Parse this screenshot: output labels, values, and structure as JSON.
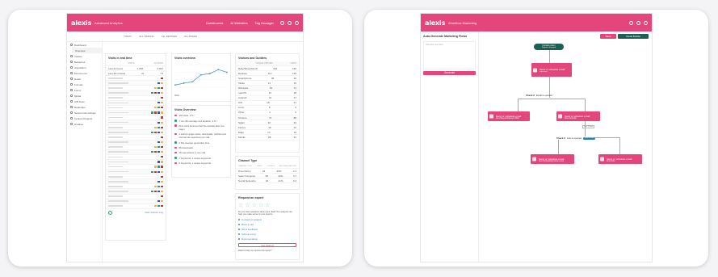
{
  "left": {
    "brand": "alexis",
    "app_title": "Advanced Analytics",
    "nav": [
      "Dashboards",
      "AI Websites",
      "Tag Manager"
    ],
    "filters": [
      "TODAY",
      "ALL TRAFFIC",
      "ALL DEVICES",
      "ALL PAGES"
    ],
    "sidebar": [
      "Dashboard",
      "Overview",
      "Visitors",
      "Behaviour",
      "Acquisition",
      "Ecommerce",
      "Goals",
      "Funnels",
      "Forms",
      "Media",
      "A/B Tests",
      "Heatmaps",
      "Session Recordings",
      "Content Projects",
      "Crashes"
    ],
    "visits": {
      "title": "Visits in real time",
      "headers": [
        "",
        "VISITS",
        "ACTIONS"
      ],
      "summary": [
        [
          "Last 24 hours",
          "1,084",
          "3,812"
        ],
        [
          "Last 30 minutes",
          "21",
          "74"
        ]
      ],
      "rows_count": 27,
      "more_link": "View Visitors Log"
    },
    "overview_title": "Visits overview",
    "chart_data": {
      "type": "line",
      "x": [
        "",
        "",
        "",
        "",
        "",
        "",
        ""
      ],
      "series": [
        {
          "values": [
            10,
            18,
            24,
            55,
            60,
            78,
            66
          ]
        }
      ],
      "legend": "Visits"
    },
    "visit_overview": {
      "title": "Visits Overview",
      "items": [
        "192 visits, 2 % ↑",
        "3 min 35s average visit duration, 4 % ↑",
        "61% visits bounced (left the website after one page)",
        "4 actions (page views, downloads, outlinks and internal site searches) per visit",
        "0.63s average generation time",
        "88 downloads",
        "18 max actions in one visit",
        "1 Keywords, 1 unique keywords",
        "8 Keywords, 1 unique keywords"
      ]
    },
    "matomo": {
      "title": "Visitors and Outliers",
      "headers": [
        "",
        "UNIQUE VISITORS",
        "VISITS"
      ],
      "rows": [
        [
          "Daily/Week/Month",
          "164",
          "192"
        ],
        [
          "Desktop",
          "112",
          "130"
        ],
        [
          "Smartphone",
          "38",
          "46"
        ],
        [
          "Tablet",
          "14",
          "16"
        ],
        [
          "Windows",
          "64",
          "74"
        ],
        [
          "macOS",
          "32",
          "38"
        ],
        [
          "Android",
          "22",
          "27"
        ],
        [
          "iOS",
          "18",
          "21"
        ],
        [
          "Linux",
          "8",
          "9"
        ],
        [
          "Other",
          "4",
          "5"
        ],
        [
          "Chrome",
          "74",
          "86"
        ],
        [
          "Safari",
          "30",
          "36"
        ],
        [
          "Firefox",
          "18",
          "22"
        ],
        [
          "Edge",
          "14",
          "16"
        ],
        [
          "Mobile",
          "28",
          "32"
        ]
      ]
    },
    "channel": {
      "title": "Channel Type",
      "headers": [
        "CHANNEL TYPE",
        "VISITS",
        "% VISITS",
        "ACTIONS PER VISIT"
      ],
      "rows": [
        [
          "Direct Entry",
          "94",
          "49%",
          "4.1"
        ],
        [
          "Search Engines",
          "58",
          "30%",
          "3.7"
        ],
        [
          "Social Networks",
          "40",
          "21%",
          "3.2"
        ]
      ]
    },
    "ask": {
      "title": "Request an expert",
      "desc": "Do you have questions about your data? Our analysts can help you make sense of your reports.",
      "links": [
        "Contact an analyst",
        "Book a call",
        "Send feedback",
        "Submit a bug",
        "Documentation"
      ],
      "button": "Get Started",
      "footer": "Want to help us improve this report?"
    }
  },
  "right": {
    "brand": "alexis",
    "app_title": "Workflow Marketing",
    "page_title": "Auto-Generate Marketing Flows",
    "placeholder": "Describe your flow",
    "generate_btn": "Generate",
    "save_btn": "Save",
    "builder_btn": "Visual Builder",
    "nodes": {
      "start": "Contact enters",
      "start_sub": "Segment: Engaged",
      "email1": "Send or schedule email",
      "email1_sub": "Welcome",
      "cond1": "Check if",
      "cond1_val": "Email is opened",
      "email2": "Send or schedule email",
      "email2_sub": "Send Special Discount Offer",
      "email3": "Send or schedule email",
      "email3_sub": "Send reminder",
      "wait_label": "Wait 2 days",
      "cond2": "Check if",
      "cond2_val": "Link is opened",
      "cond2_chip": "Link clicked",
      "email4": "Send or schedule email",
      "email4_sub": "Send Onboarding Guide email",
      "email5": "Send or schedule email",
      "email5_sub": "Send offer"
    }
  }
}
